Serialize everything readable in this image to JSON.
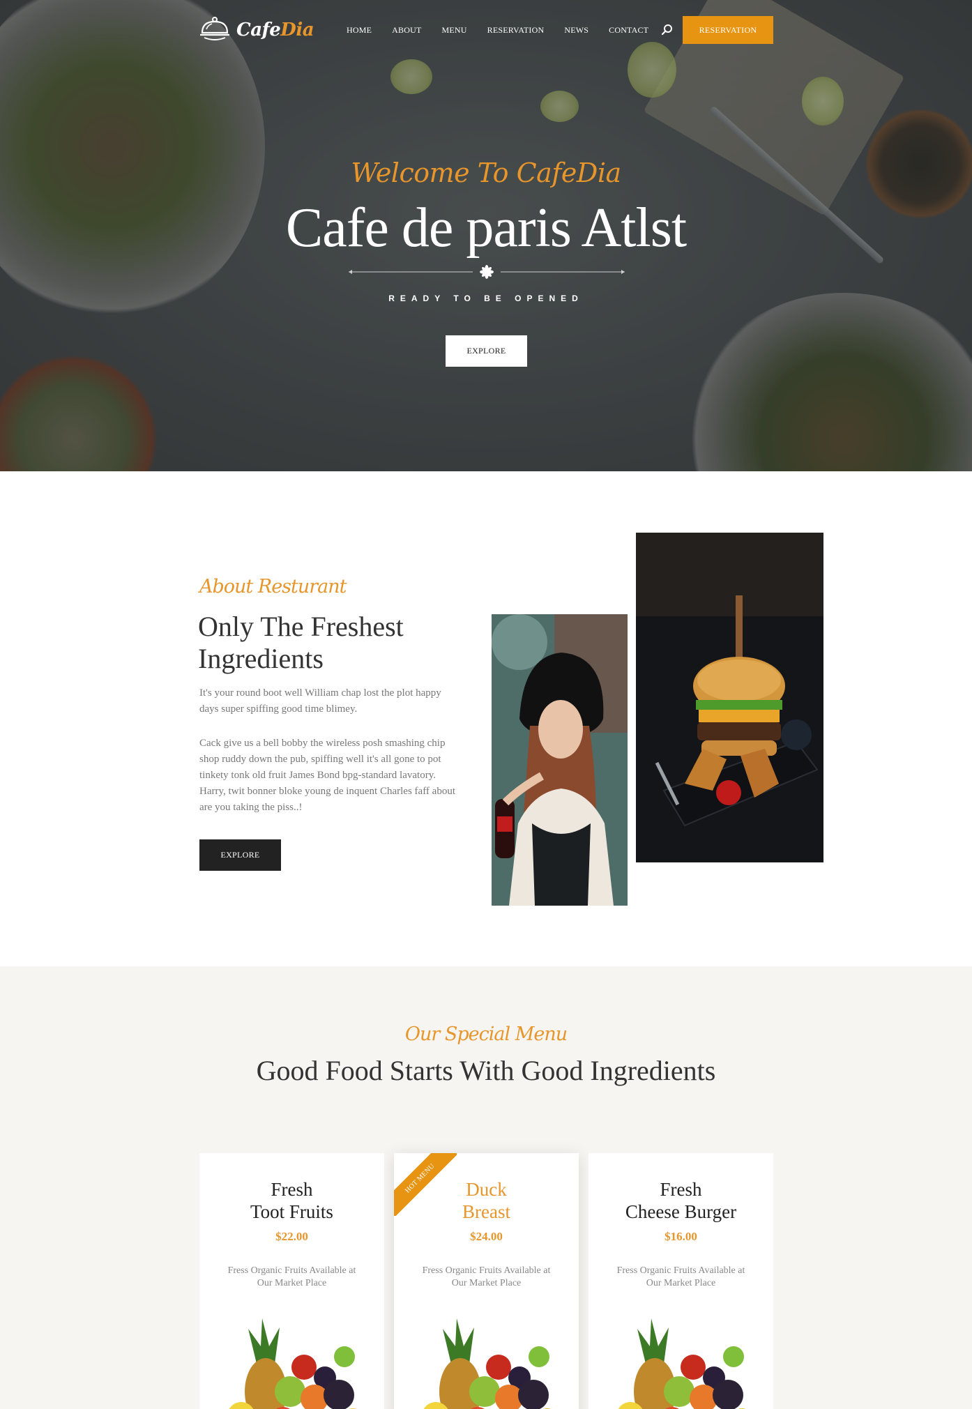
{
  "brand": {
    "name_part1": "Cafe",
    "name_part2": "Dia"
  },
  "nav": {
    "items": [
      "HOME",
      "ABOUT",
      "MENU",
      "RESERVATION",
      "NEWS",
      "CONTACT"
    ],
    "cta": "RESERVATION"
  },
  "hero": {
    "script": "Welcome To CafeDia",
    "title": "Cafe de paris Atlst",
    "subtitle": "READY TO BE OPENED",
    "button": "EXPLORE"
  },
  "about": {
    "script": "About Resturant",
    "title": "Only The Freshest Ingredients",
    "paragraph1": "It's your round boot well William chap lost the plot happy days super spiffing good time blimey.",
    "paragraph2": "Cack give us a bell bobby the wireless posh smashing chip shop ruddy down the pub, spiffing well it's all gone to pot tinkety tonk old fruit James Bond bpg-standard lavatory. Harry, twit bonner bloke young de inquent Charles faff about are you taking the piss..!",
    "button": "EXPLORE"
  },
  "menu": {
    "script": "Our Special Menu",
    "title": "Good Food Starts With Good Ingredients",
    "ribbon": "HOT MENU",
    "cards": [
      {
        "name_line1": "Fresh",
        "name_line2": "Toot Fruits",
        "price": "$22.00",
        "desc": "Fress Organic Fruits Available at Our Market Place"
      },
      {
        "name_line1": "Duck",
        "name_line2": "Breast",
        "price": "$24.00",
        "desc": "Fress Organic Fruits Available at Our Market Place"
      },
      {
        "name_line1": "Fresh",
        "name_line2": "Cheese Burger",
        "price": "$16.00",
        "desc": "Fress Organic Fruits Available at Our Market Place"
      }
    ]
  },
  "colors": {
    "accent": "#e69412",
    "dark": "#222222",
    "section_bg": "#f6f5f1"
  },
  "icons": [
    "cloche-logo-icon",
    "search-icon",
    "flower-divider-icon"
  ]
}
